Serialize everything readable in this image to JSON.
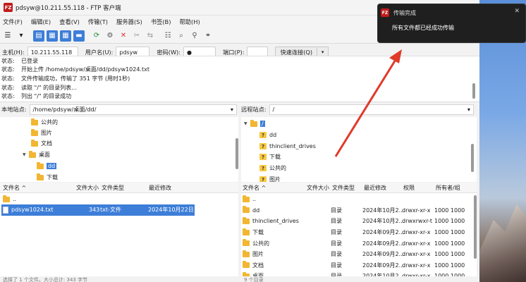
{
  "window": {
    "title": "pdsyw@10.211.55.118 - FTP 客户端",
    "app_icon": "FZ"
  },
  "menu": [
    "文件(F)",
    "编辑(E)",
    "查看(V)",
    "传输(T)",
    "服务器(S)",
    "书签(B)",
    "帮助(H)"
  ],
  "toolbar_icons": {
    "site-manager": "☰",
    "dropdown": "▾",
    "toggle-log": "▤",
    "toggle-local-tree": "▦",
    "toggle-remote-tree": "▦",
    "toggle-queue": "▬",
    "refresh": "⟳",
    "process-queue": "⚙",
    "cancel": "✕",
    "disconnect": "✂",
    "reconnect": "⇆",
    "dir-compare": "☷",
    "search": "⌕",
    "filter": "⚲",
    "binoculars": "⚭"
  },
  "quickconnect": {
    "host_label": "主机(H):",
    "host": "10.211.55.118",
    "user_label": "用户名(U):",
    "user": "pdsyw",
    "pass_label": "密码(W):",
    "pass": "●",
    "port_label": "端口(P):",
    "port": "",
    "connect_label": "快速连接(Q)"
  },
  "log": [
    {
      "k": "状态:",
      "v": "已登录"
    },
    {
      "k": "状态:",
      "v": "开始上传 /home/pdsyw/桌面/dd/pdsyw1024.txt"
    },
    {
      "k": "状态:",
      "v": "文件传输成功，传输了 351 字节 (用时1秒)"
    },
    {
      "k": "状态:",
      "v": "读取 \"/\" 的目录列表..."
    },
    {
      "k": "状态:",
      "v": "列出 \"/\" 的目录成功"
    }
  ],
  "local": {
    "site_label": "本地站点:",
    "path": "/home/pdsyw/桌面/dd/",
    "tree": [
      "公共的",
      "图片",
      "文档",
      "桌面",
      "dd",
      "下载"
    ],
    "headers": {
      "name": "文件名",
      "size": "文件大小",
      "type": "文件类型",
      "modified": "最近修改"
    },
    "files": [
      {
        "name": "..",
        "size": "",
        "type": "",
        "modified": ""
      },
      {
        "name": "pdsyw1024.txt",
        "size": "343",
        "type": "txt-文件",
        "modified": "2024年10月22日 ..."
      }
    ],
    "status": "选择了 1 个文件。大小总计: 343 字节"
  },
  "remote": {
    "site_label": "远程站点:",
    "path": "/",
    "tree": [
      "/",
      "dd",
      "thinclient_drives",
      "下载",
      "公共的",
      "图片"
    ],
    "headers": {
      "name": "文件名",
      "size": "文件大小",
      "type": "文件类型",
      "modified": "最近修改",
      "perm": "权限",
      "owner": "所有者/组"
    },
    "files": [
      {
        "name": "..",
        "type": "",
        "modified": "",
        "perm": "",
        "owner": ""
      },
      {
        "name": "dd",
        "type": "目录",
        "modified": "2024年10月2...",
        "perm": "drwxr-xr-x",
        "owner": "1000 1000"
      },
      {
        "name": "thinclient_drives",
        "type": "目录",
        "modified": "2024年10月2...",
        "perm": "drwxrwxr-t",
        "owner": "1000 1000"
      },
      {
        "name": "下载",
        "type": "目录",
        "modified": "2024年09月2...",
        "perm": "drwxr-xr-x",
        "owner": "1000 1000"
      },
      {
        "name": "公共的",
        "type": "目录",
        "modified": "2024年09月2...",
        "perm": "drwxr-xr-x",
        "owner": "1000 1000"
      },
      {
        "name": "图片",
        "type": "目录",
        "modified": "2024年09月2...",
        "perm": "drwxr-xr-x",
        "owner": "1000 1000"
      },
      {
        "name": "文档",
        "type": "目录",
        "modified": "2024年09月2...",
        "perm": "drwxr-xr-x",
        "owner": "1000 1000"
      },
      {
        "name": "桌面",
        "type": "目录",
        "modified": "2024年10月2...",
        "perm": "drwxr-xr-x",
        "owner": "1000 1000"
      }
    ],
    "status": "9 个目录"
  },
  "notification": {
    "title": "传输完成",
    "message": "所有文件都已经成功传输",
    "close": "✕"
  },
  "colors": {
    "accent": "#3d7ed8",
    "arrow": "#e03a2a",
    "folder": "#f2b632"
  }
}
